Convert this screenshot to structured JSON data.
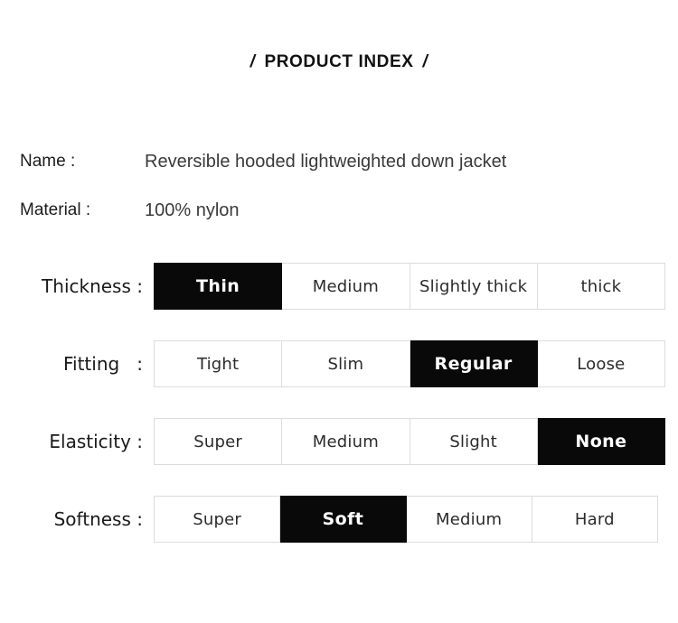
{
  "header": {
    "left_slash": "/",
    "title": "PRODUCT INDEX",
    "right_slash": "/"
  },
  "info": [
    {
      "label": "Name :",
      "value": "Reversible hooded lightweighted down jacket"
    },
    {
      "label": "Material :",
      "value": "100% nylon"
    }
  ],
  "attributes": [
    {
      "label": "Thickness :",
      "selected": "Thin",
      "options": [
        {
          "text": "Thin",
          "selected": true
        },
        {
          "text": "Medium",
          "selected": false
        },
        {
          "text": "Slightly thick",
          "selected": false
        },
        {
          "text": "thick",
          "selected": false
        }
      ]
    },
    {
      "label": "Fitting   :",
      "selected": "Regular",
      "options": [
        {
          "text": "Tight",
          "selected": false
        },
        {
          "text": "Slim",
          "selected": false
        },
        {
          "text": "Regular",
          "selected": true
        },
        {
          "text": "Loose",
          "selected": false
        }
      ]
    },
    {
      "label": "Elasticity :",
      "selected": "None",
      "options": [
        {
          "text": "Super",
          "selected": false
        },
        {
          "text": "Medium",
          "selected": false
        },
        {
          "text": "Slight",
          "selected": false
        },
        {
          "text": "None",
          "selected": true
        }
      ]
    },
    {
      "label": "Softness :",
      "selected": "Soft",
      "options": [
        {
          "text": "Super",
          "selected": false
        },
        {
          "text": "Soft",
          "selected": true
        },
        {
          "text": "Medium",
          "selected": false
        },
        {
          "text": "Hard",
          "selected": false
        }
      ]
    }
  ],
  "colors": {
    "background": "#ffffff",
    "text": "#1a1a1a",
    "value_text": "#3a3a3a",
    "cell_border": "#dcdcdc",
    "selected_background": "#090909",
    "selected_text": "#ffffff"
  }
}
